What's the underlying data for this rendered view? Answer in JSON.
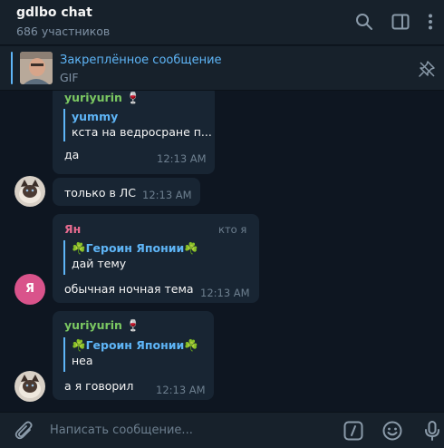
{
  "header": {
    "title": "gdlbo chat",
    "subtitle": "686 участников"
  },
  "pinned": {
    "title": "Закреплённое сообщение",
    "subtitle": "GIF"
  },
  "messages": [
    {
      "sender": "yuriyurin 🍷",
      "sender_color": "#7bc862",
      "reply_name": "yummy",
      "reply_text": "кста на ведросране п...",
      "text": "да",
      "time": "12:13 AM"
    },
    {
      "text": "только в ЛС",
      "time": "12:13 AM"
    },
    {
      "sender": "Ян",
      "sender_color": "#e66b8f",
      "role": "кто я",
      "avatar_letter": "Я",
      "reply_name": "☘️Героин Японии☘️",
      "reply_text": "дай тему",
      "text": "обычная ночная тема",
      "time": "12:13 AM"
    },
    {
      "sender": "yuriyurin 🍷",
      "sender_color": "#7bc862",
      "reply_name": "☘️Героин Японии☘️",
      "reply_text": "неа",
      "text": "а я говорил",
      "time": "12:13 AM"
    }
  ],
  "composer": {
    "placeholder": "Написать сообщение..."
  },
  "icons": {
    "search": "search-icon",
    "sidebar": "sidebar-toggle-icon",
    "more": "more-vertical-icon",
    "unpin": "unpin-icon",
    "attach": "paperclip-icon",
    "commands": "bot-commands-icon",
    "emoji": "emoji-icon",
    "mic": "microphone-icon"
  },
  "colors": {
    "background": "#0e1621",
    "panel": "#17212b",
    "bubble": "#182533",
    "accent": "#5eb5f7"
  }
}
